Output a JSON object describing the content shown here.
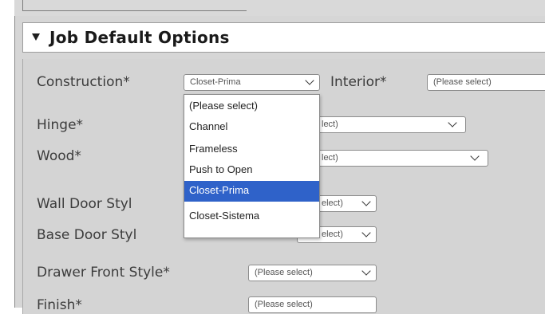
{
  "section": {
    "title": "Job Default Options"
  },
  "fields": {
    "construction": {
      "label": "Construction*",
      "value": "Closet-Prima"
    },
    "interior": {
      "label": "Interior*",
      "value": "(Please select)"
    },
    "hinge": {
      "label": "Hinge*",
      "value_partial": "lect)"
    },
    "wood": {
      "label": "Wood*",
      "value_partial": "lect)"
    },
    "wall_door_style": {
      "label": "Wall Door Styl",
      "value_partial": "elect)"
    },
    "base_door_style": {
      "label": "Base Door Styl",
      "value_partial": "elect)"
    },
    "drawer_front_style": {
      "label": "Drawer Front Style*",
      "value": "(Please select)"
    },
    "finish": {
      "label": "Finish*",
      "value": "(Please select)"
    }
  },
  "construction_dropdown": {
    "options": [
      "(Please select)",
      "Channel",
      "Frameless",
      "Push to Open",
      "Closet-Prima",
      "Closet-Sistema"
    ],
    "selected": "Closet-Prima"
  },
  "colors": {
    "selected_option_bg": "#2f62c9",
    "panel_bg": "#d4d4d4"
  }
}
